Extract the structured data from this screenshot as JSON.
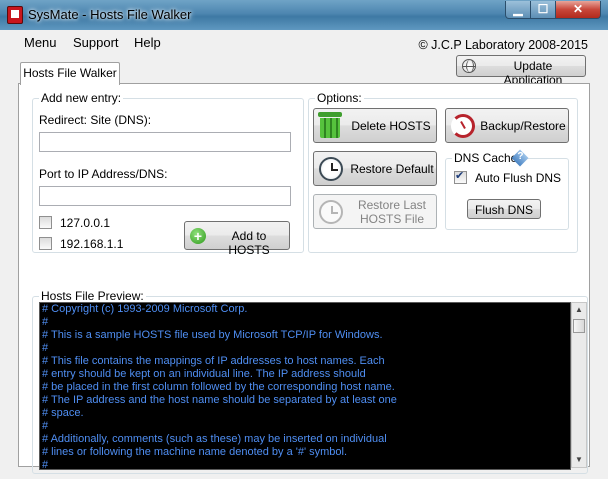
{
  "window": {
    "title": "SysMate - Hosts File Walker",
    "controls": {
      "minimize": "▁",
      "maximize": "☐",
      "close": "✕"
    }
  },
  "menu": {
    "items": [
      "Menu",
      "Support",
      "Help"
    ],
    "copyright": "© J.C.P Laboratory 2008-2015",
    "update_label": "Update Application"
  },
  "tab": {
    "label": "Hosts File Walker"
  },
  "add_entry": {
    "group_label": "Add new entry:",
    "redirect_label": "Redirect: Site (DNS):",
    "redirect_value": "",
    "port_label": "Port to IP Address/DNS:",
    "port_value": "",
    "options": [
      {
        "label": "127.0.0.1",
        "checked": false
      },
      {
        "label": "192.168.1.1",
        "checked": false
      }
    ],
    "add_label": "Add to HOSTS"
  },
  "options": {
    "group_label": "Options:",
    "delete_label": "Delete HOSTS",
    "backup_label": "Backup/Restore",
    "restore_default_label": "Restore Default",
    "restore_last_line1": "Restore Last",
    "restore_last_line2": "HOSTS File",
    "dns_cache": {
      "label": "DNS Cache",
      "auto_flush_label": "Auto Flush DNS",
      "auto_flush_checked": true,
      "flush_label": "Flush DNS",
      "help_glyph": "?"
    }
  },
  "preview": {
    "group_label": "Hosts File Preview:",
    "lines": [
      "# Copyright (c) 1993-2009 Microsoft Corp.",
      "#",
      "# This is a sample HOSTS file used by Microsoft TCP/IP for Windows.",
      "#",
      "# This file contains the mappings of IP addresses to host names. Each",
      "# entry should be kept on an individual line. The IP address should",
      "# be placed in the first column followed by the corresponding host name.",
      "# The IP address and the host name should be separated by at least one",
      "# space.",
      "#",
      "# Additionally, comments (such as these) may be inserted on individual",
      "# lines or following the machine name denoted by a '#' symbol.",
      "#"
    ],
    "scroll_up": "▲",
    "scroll_down": "▼"
  }
}
